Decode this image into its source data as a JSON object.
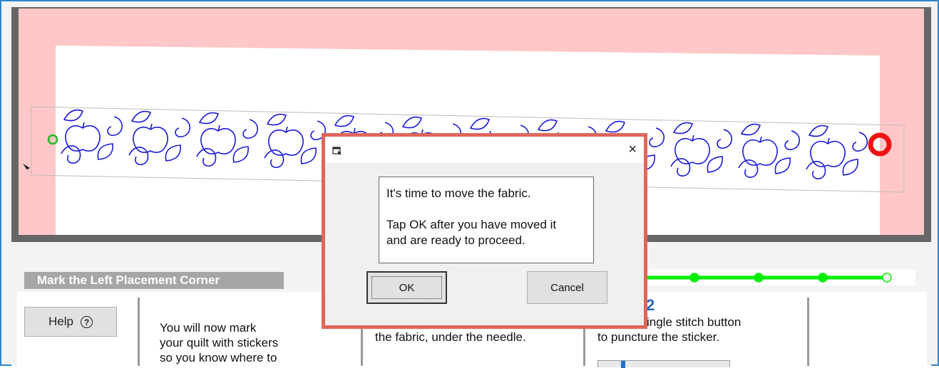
{
  "section": {
    "title": "Mark the Left Placement Corner"
  },
  "help": {
    "label": "Help",
    "icon": "question-circle-icon",
    "glyph": "?"
  },
  "steps": [
    {
      "text": "You will now mark\nyour quilt with stickers\nso you know where to"
    },
    {
      "text": "Place another sticker on\nthe fabric, under the needle."
    },
    {
      "text": "Tap the single stitch button\nto puncture the sticker."
    }
  ],
  "step_number": "2",
  "progress": {
    "total_steps": 5,
    "completed_steps": 4,
    "color": "#00ee00"
  },
  "dialog": {
    "message_line1": "It's time to move the fabric.",
    "message_line2": "Tap OK after you have moved it",
    "message_line3": "and are ready to proceed.",
    "ok_label": "OK",
    "cancel_label": "Cancel",
    "close_glyph": "×",
    "highlight_color": "#e0665a"
  },
  "colors": {
    "canvas_pink": "#ffc7c7",
    "pattern_blue": "#1b1bd8",
    "marker_red": "#ee1111",
    "start_green": "#22bb22"
  }
}
